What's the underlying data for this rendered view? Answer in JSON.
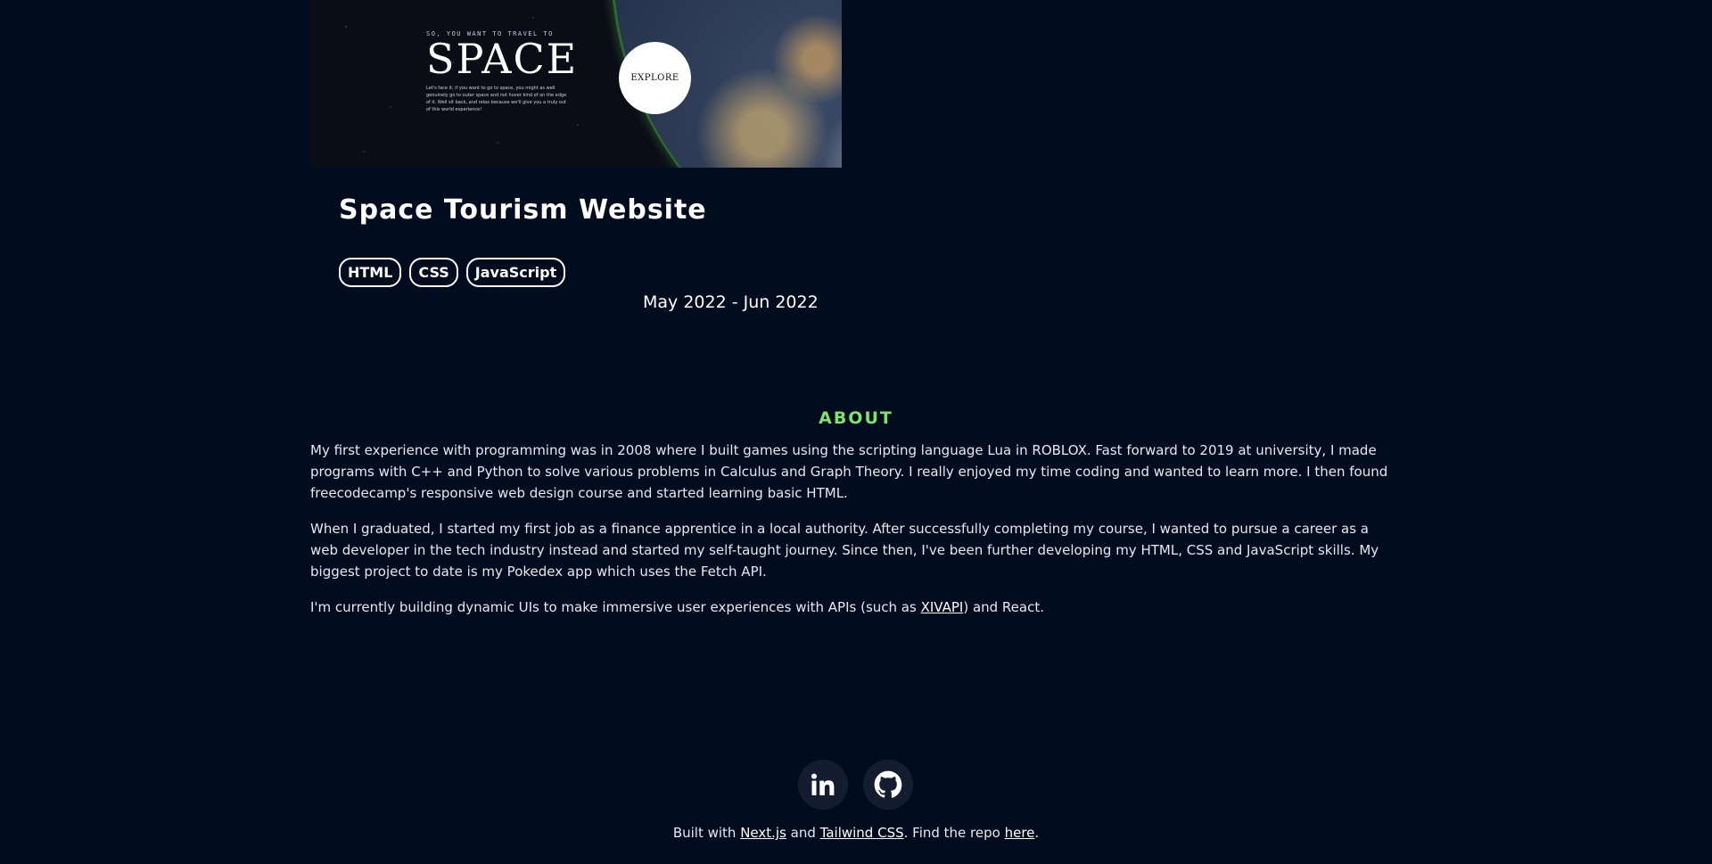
{
  "project": {
    "image": {
      "eyebrow": "SO, YOU WANT TO TRAVEL TO",
      "title": "SPACE",
      "text": "Let's face it; if you want to go to space, you might as well genuinely go to outer space and not hover kind of on the edge of it. Well sit back, and relax because we'll give you a truly out of this world experience!",
      "explore_label": "EXPLORE"
    },
    "title": "Space Tourism Website",
    "tags": [
      "HTML",
      "CSS",
      "JavaScript"
    ],
    "date_range": "May 2022 - Jun 2022"
  },
  "about": {
    "heading": "ABOUT",
    "p1": "My first experience with programming was in 2008 where I built games using the scripting language Lua in ROBLOX. Fast forward to 2019 at university, I made programs with C++ and Python to solve various problems in Calculus and Graph Theory. I really enjoyed my time coding and wanted to learn more. I then found freecodecamp's responsive web design course and started learning basic HTML.",
    "p2": "When I graduated, I started my first job as a finance apprentice in a local authority. After successfully completing my course, I wanted to pursue a career as a web developer in the tech industry instead and started my self-taught journey. Since then, I've been further developing my HTML, CSS and JavaScript skills. My biggest project to date is my Pokedex app which uses the Fetch API.",
    "p3_before": "I'm currently building dynamic UIs to make immersive user experiences with APIs (such as ",
    "p3_link": "XIVAPI",
    "p3_after": ") and React."
  },
  "socials": {
    "linkedin_icon": "linkedin-icon",
    "github_icon": "github-icon"
  },
  "footer": {
    "built_with": "Built with ",
    "nextjs": "Next.js",
    "and": " and ",
    "tailwind": "Tailwind CSS",
    "find_repo": ". Find the repo ",
    "here": "here",
    "period": "."
  },
  "colors": {
    "background": "#020c1f",
    "accent": "#7ee36b"
  }
}
